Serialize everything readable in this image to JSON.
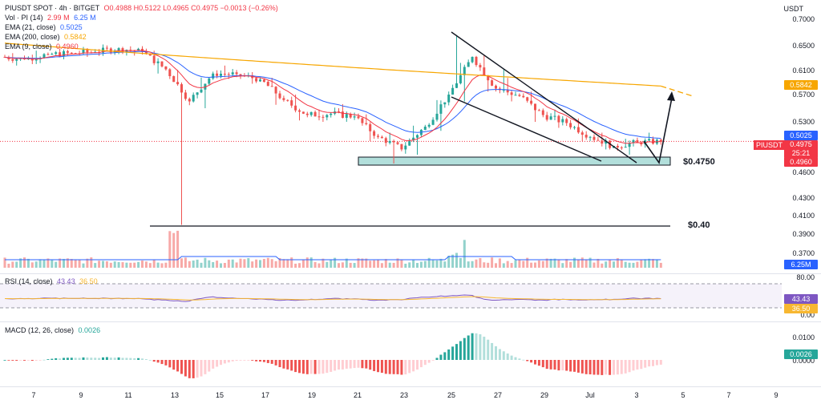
{
  "header": {
    "symbol_line": "PIUSDT SPOT · 4h · BITGET",
    "ohlc": "O0.4988 H0.5122 L0.4965 C0.4975 −0.0013 (−0.26%)",
    "vol_label": "Vol · PI (14)",
    "vol_v1": "2.99 M",
    "vol_v2": "6.25 M",
    "ema21_label": "EMA (21, close)",
    "ema21_v": "0.5025",
    "ema200_label": "EMA (200, close)",
    "ema200_v": "0.5842",
    "ema9_label": "EMA (9, close)",
    "ema9_v": "0.4960",
    "rsi_label": "RSI (14, close)",
    "rsi_v1": "43.43",
    "rsi_v2": "36.50",
    "macd_label": "MACD (12, 26, close)",
    "macd_v": "0.0026",
    "currency": "USDT"
  },
  "price_tags": {
    "ema200": "0.5842",
    "ema21": "0.5025",
    "last": "0.4975",
    "countdown": "25:21",
    "ema9": "0.4960",
    "symbol": "PIUSDT",
    "volume": "6.25M",
    "rsi1": "43.43",
    "rsi2": "36.50",
    "macd": "0.0026"
  },
  "annotations": {
    "support": "$0.4750",
    "low": "$0.40"
  },
  "colors": {
    "up": "#26a69a",
    "down": "#ef5350",
    "ema21": "#2962ff",
    "ema200": "#f7a600",
    "ema9": "#f23645",
    "rsi": "#7e57c2",
    "rsi_ma": "#f7b731",
    "zone": "#b2dfdb"
  },
  "chart_data": {
    "type": "candlestick",
    "timeframe": "4h",
    "x_ticks": [
      "7",
      "9",
      "11",
      "13",
      "15",
      "17",
      "19",
      "21",
      "23",
      "25",
      "27",
      "29",
      "Jul",
      "3",
      "5",
      "7",
      "9"
    ],
    "y_ticks": [
      "0.7000",
      "0.6500",
      "0.6100",
      "0.5700",
      "0.5300",
      "0.4900",
      "0.4600",
      "0.4300",
      "0.4100",
      "0.3900",
      "0.3700"
    ],
    "rsi_ticks": [
      "80.00",
      "0.00"
    ],
    "macd_ticks": [
      "0.0100",
      "0.0000"
    ],
    "daily_ohlc_estimates": [
      {
        "d": "6",
        "o": 0.632,
        "h": 0.638,
        "l": 0.618,
        "c": 0.628
      },
      {
        "d": "7",
        "o": 0.628,
        "h": 0.642,
        "l": 0.622,
        "c": 0.636
      },
      {
        "d": "8",
        "o": 0.636,
        "h": 0.645,
        "l": 0.628,
        "c": 0.638
      },
      {
        "d": "9",
        "o": 0.638,
        "h": 0.648,
        "l": 0.632,
        "c": 0.64
      },
      {
        "d": "10",
        "o": 0.64,
        "h": 0.65,
        "l": 0.636,
        "c": 0.646
      },
      {
        "d": "11",
        "o": 0.646,
        "h": 0.649,
        "l": 0.634,
        "c": 0.64
      },
      {
        "d": "12",
        "o": 0.64,
        "h": 0.642,
        "l": 0.605,
        "c": 0.612
      },
      {
        "d": "13",
        "o": 0.612,
        "h": 0.618,
        "l": 0.4,
        "c": 0.56
      },
      {
        "d": "14",
        "o": 0.56,
        "h": 0.612,
        "l": 0.55,
        "c": 0.605
      },
      {
        "d": "15",
        "o": 0.605,
        "h": 0.618,
        "l": 0.596,
        "c": 0.604
      },
      {
        "d": "16",
        "o": 0.604,
        "h": 0.606,
        "l": 0.588,
        "c": 0.595
      },
      {
        "d": "17",
        "o": 0.595,
        "h": 0.598,
        "l": 0.555,
        "c": 0.562
      },
      {
        "d": "18",
        "o": 0.562,
        "h": 0.57,
        "l": 0.532,
        "c": 0.54
      },
      {
        "d": "19",
        "o": 0.54,
        "h": 0.548,
        "l": 0.53,
        "c": 0.542
      },
      {
        "d": "20",
        "o": 0.542,
        "h": 0.556,
        "l": 0.535,
        "c": 0.538
      },
      {
        "d": "21",
        "o": 0.538,
        "h": 0.541,
        "l": 0.498,
        "c": 0.505
      },
      {
        "d": "22",
        "o": 0.505,
        "h": 0.512,
        "l": 0.47,
        "c": 0.486
      },
      {
        "d": "23",
        "o": 0.486,
        "h": 0.528,
        "l": 0.48,
        "c": 0.522
      },
      {
        "d": "24",
        "o": 0.522,
        "h": 0.58,
        "l": 0.515,
        "c": 0.57
      },
      {
        "d": "25",
        "o": 0.57,
        "h": 0.67,
        "l": 0.56,
        "c": 0.632
      },
      {
        "d": "26",
        "o": 0.632,
        "h": 0.64,
        "l": 0.575,
        "c": 0.58
      },
      {
        "d": "27",
        "o": 0.58,
        "h": 0.612,
        "l": 0.56,
        "c": 0.568
      },
      {
        "d": "28",
        "o": 0.568,
        "h": 0.575,
        "l": 0.53,
        "c": 0.54
      },
      {
        "d": "29",
        "o": 0.54,
        "h": 0.548,
        "l": 0.52,
        "c": 0.528
      },
      {
        "d": "30",
        "o": 0.528,
        "h": 0.535,
        "l": 0.498,
        "c": 0.505
      },
      {
        "d": "Jul 1",
        "o": 0.505,
        "h": 0.512,
        "l": 0.486,
        "c": 0.49
      },
      {
        "d": "Jul 2",
        "o": 0.49,
        "h": 0.502,
        "l": 0.48,
        "c": 0.496
      },
      {
        "d": "Jul 3",
        "o": 0.496,
        "h": 0.512,
        "l": 0.492,
        "c": 0.4975
      }
    ],
    "support_zone": [
      0.466,
      0.475
    ],
    "horizontal_level": 0.4,
    "ema200_range": [
      0.655,
      0.5842
    ],
    "legend": [
      "EMA (21, close)",
      "EMA (200, close)",
      "EMA (9, close)",
      "Vol · PI (14)"
    ],
    "rsi_levels": [
      70,
      30
    ]
  }
}
